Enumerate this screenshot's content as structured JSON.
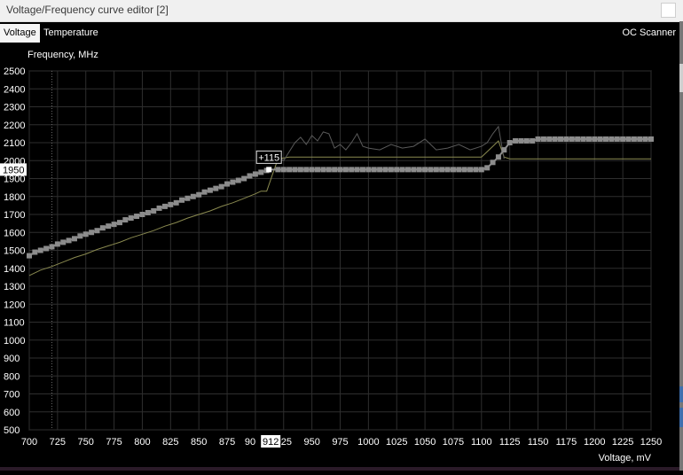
{
  "window": {
    "title": "Voltage/Frequency curve editor [2]"
  },
  "tabs": [
    {
      "label": "Voltage",
      "active": true
    },
    {
      "label": "Temperature",
      "active": false
    }
  ],
  "oc_scanner_label": "OC Scanner",
  "chart_data": {
    "type": "line",
    "ylabel": "Frequency, MHz",
    "xlabel": "Voltage, mV",
    "xlim": [
      700,
      1250
    ],
    "ylim": [
      500,
      2500
    ],
    "xticks": [
      "700",
      "725",
      "750",
      "775",
      "800",
      "825",
      "850",
      "875",
      "900",
      "925",
      "950",
      "975",
      "1000",
      "1025",
      "1050",
      "1075",
      "1100",
      "1125",
      "1150",
      "1175",
      "1200",
      "1225",
      "1250"
    ],
    "yticks": [
      "500",
      "600",
      "700",
      "800",
      "900",
      "1000",
      "1100",
      "1200",
      "1300",
      "1400",
      "1500",
      "1600",
      "1700",
      "1800",
      "1900",
      "2000",
      "2100",
      "2200",
      "2300",
      "2400",
      "2500"
    ],
    "grid": true,
    "colors": {
      "background": "#000000",
      "grid": "#2e2e2e",
      "curve": "#8c8c8c",
      "points": "#8c8c8c",
      "selected": "#ffffff",
      "default_curve": "#8a8a50",
      "actual_trace": "#5a5a5a"
    },
    "series": [
      {
        "role": "edited",
        "x": [
          700,
          705,
          710,
          715,
          720,
          725,
          730,
          735,
          740,
          745,
          750,
          755,
          760,
          765,
          770,
          775,
          780,
          785,
          790,
          795,
          800,
          805,
          810,
          815,
          820,
          825,
          830,
          835,
          840,
          845,
          850,
          855,
          860,
          865,
          870,
          875,
          880,
          885,
          890,
          895,
          900,
          905,
          910,
          912,
          920,
          925,
          930,
          935,
          940,
          945,
          950,
          955,
          960,
          965,
          970,
          975,
          980,
          985,
          990,
          995,
          1000,
          1005,
          1010,
          1015,
          1020,
          1025,
          1030,
          1035,
          1040,
          1045,
          1050,
          1055,
          1060,
          1065,
          1070,
          1075,
          1080,
          1085,
          1090,
          1095,
          1100,
          1105,
          1110,
          1115,
          1120,
          1125,
          1130,
          1135,
          1140,
          1145,
          1150,
          1155,
          1160,
          1165,
          1170,
          1175,
          1180,
          1185,
          1190,
          1195,
          1200,
          1205,
          1210,
          1215,
          1220,
          1225,
          1230,
          1235,
          1240,
          1245,
          1250
        ],
        "y": [
          1470,
          1490,
          1500,
          1510,
          1520,
          1535,
          1545,
          1555,
          1565,
          1580,
          1590,
          1600,
          1610,
          1625,
          1635,
          1645,
          1655,
          1670,
          1680,
          1690,
          1700,
          1710,
          1720,
          1735,
          1745,
          1755,
          1765,
          1780,
          1790,
          1800,
          1810,
          1825,
          1835,
          1845,
          1855,
          1870,
          1880,
          1890,
          1900,
          1915,
          1925,
          1935,
          1945,
          1950,
          1950,
          1950,
          1950,
          1950,
          1950,
          1950,
          1950,
          1950,
          1950,
          1950,
          1950,
          1950,
          1950,
          1950,
          1950,
          1950,
          1950,
          1950,
          1950,
          1950,
          1950,
          1950,
          1950,
          1950,
          1950,
          1950,
          1950,
          1950,
          1950,
          1950,
          1950,
          1950,
          1950,
          1950,
          1950,
          1950,
          1950,
          1960,
          1990,
          2020,
          2060,
          2100,
          2110,
          2110,
          2110,
          2110,
          2120,
          2120,
          2120,
          2120,
          2120,
          2120,
          2120,
          2120,
          2120,
          2120,
          2120,
          2120,
          2120,
          2120,
          2120,
          2120,
          2120,
          2120,
          2120,
          2120,
          2120
        ]
      },
      {
        "role": "default",
        "x": [
          700,
          710,
          720,
          730,
          740,
          750,
          760,
          770,
          780,
          790,
          800,
          810,
          820,
          830,
          840,
          850,
          860,
          870,
          880,
          890,
          900,
          905,
          910,
          915,
          920,
          930,
          940,
          950,
          960,
          970,
          980,
          990,
          1000,
          1010,
          1020,
          1030,
          1040,
          1050,
          1060,
          1070,
          1080,
          1090,
          1100,
          1110,
          1115,
          1120,
          1125,
          1130,
          1140,
          1150,
          1175,
          1200,
          1225,
          1250
        ],
        "y": [
          1360,
          1390,
          1410,
          1435,
          1460,
          1480,
          1505,
          1525,
          1545,
          1570,
          1590,
          1610,
          1635,
          1655,
          1680,
          1700,
          1720,
          1745,
          1765,
          1790,
          1815,
          1830,
          1830,
          1920,
          2010,
          2020,
          2020,
          2020,
          2020,
          2020,
          2020,
          2020,
          2020,
          2020,
          2020,
          2020,
          2020,
          2020,
          2020,
          2020,
          2020,
          2020,
          2020,
          2080,
          2110,
          2020,
          2010,
          2010,
          2010,
          2010,
          2010,
          2010,
          2010,
          2010
        ]
      },
      {
        "role": "actual",
        "x": [
          920,
          925,
          930,
          935,
          940,
          945,
          950,
          955,
          960,
          965,
          970,
          975,
          980,
          985,
          990,
          995,
          1000,
          1010,
          1020,
          1030,
          1040,
          1050,
          1060,
          1070,
          1080,
          1090,
          1100,
          1105,
          1110,
          1115,
          1120
        ],
        "y": [
          2020,
          2000,
          2050,
          2100,
          2130,
          2090,
          2140,
          2110,
          2160,
          2150,
          2070,
          2090,
          2060,
          2100,
          2150,
          2080,
          2070,
          2060,
          2090,
          2070,
          2080,
          2120,
          2060,
          2070,
          2090,
          2060,
          2080,
          2100,
          2150,
          2190,
          2010
        ]
      }
    ],
    "selected": {
      "x": 912,
      "y": 1950,
      "offset_label": "+115",
      "x_label": "912",
      "y_label": "1950"
    },
    "reference_line_x": 720
  }
}
